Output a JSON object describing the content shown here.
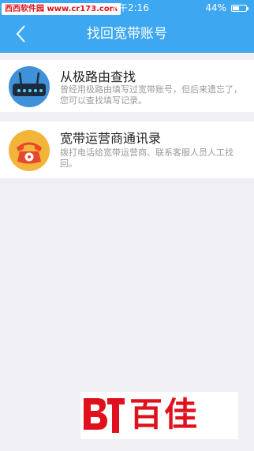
{
  "status": {
    "watermark": "西西软件园 www.cr173.com",
    "time": "下午2:16",
    "battery": "44%"
  },
  "nav": {
    "title": "找回宽带账号"
  },
  "options": [
    {
      "title": "从极路由查找",
      "description": "曾经用极路由填写过宽带账号，但后来遗忘了，您可以查找填写记录。",
      "icon": "router-icon"
    },
    {
      "title": "宽带运营商通讯录",
      "description": "拨打电话给宽带运营商、联系客服人员人工找回。",
      "icon": "telephone-icon"
    }
  ],
  "footer_logo": {
    "text": "百佳"
  },
  "colors": {
    "nav_bg": "#3da7f1",
    "page_bg": "#efeff4",
    "router_icon_bg": "#3f92d9",
    "phone_icon_bg": "#f2b53a",
    "logo_red": "#e0111d"
  }
}
